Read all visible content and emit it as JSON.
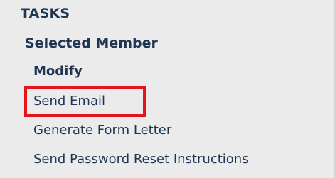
{
  "panel": {
    "title": "TASKS",
    "section_title": "Selected Member",
    "items": [
      {
        "label": "Modify",
        "bold": true
      },
      {
        "label": "Send Email",
        "bold": false,
        "highlighted": true
      },
      {
        "label": "Generate Form Letter",
        "bold": false
      },
      {
        "label": "Send Password Reset Instructions",
        "bold": false
      }
    ]
  },
  "colors": {
    "background": "#ebebeb",
    "text": "#1f3554",
    "highlight": "#e5141b"
  }
}
